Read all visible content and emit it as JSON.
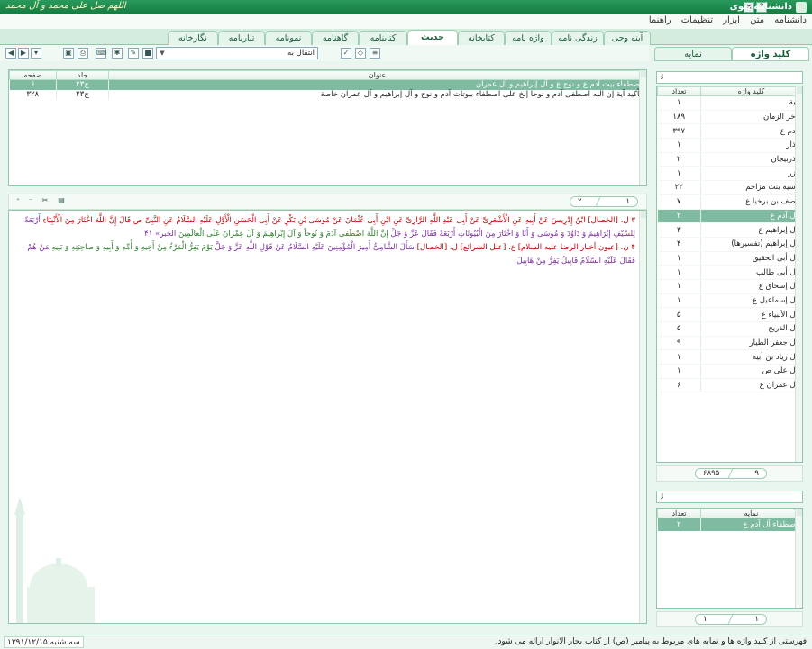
{
  "window": {
    "title": "دانشنامه نبوی",
    "calligraphy": "اللهم صل على محمد و آل محمد",
    "help_btn": "?",
    "close_btn": "×"
  },
  "menu": [
    "دانشنامه",
    "متن",
    "ابزار",
    "تنظیمات",
    "راهنما"
  ],
  "main_tabs": [
    {
      "label": "آینه وحی"
    },
    {
      "label": "زندگی نامه"
    },
    {
      "label": "واژه نامه"
    },
    {
      "label": "کتابخانه"
    },
    {
      "label": "حدیث",
      "active": true
    },
    {
      "label": "کتابنامه"
    },
    {
      "label": "گاهنامه"
    },
    {
      "label": "نمونامه"
    },
    {
      "label": "تبارنامه"
    },
    {
      "label": "نگارخانه"
    }
  ],
  "toolbar": {
    "combo_label": "انتقال به",
    "icons": [
      "back-icon",
      "forward-icon",
      "refresh-icon",
      "bookmark-icon",
      "print-icon",
      "keyboard-icon",
      "settings-icon",
      "edit-icon"
    ]
  },
  "right_tabs": [
    {
      "label": "کلید واژه",
      "active": true
    },
    {
      "label": "نمایه"
    }
  ],
  "results": {
    "headers": {
      "title": "عنوان",
      "volume": "جلد",
      "page": "صفحه"
    },
    "rows": [
      {
        "title": "اصطفاء بیت آدم ع و نوح ع و آل إبراهیم و آل عمران",
        "volume": "ج۲۳",
        "page": "۶",
        "selected": true
      },
      {
        "title": "تأکید آیة إن الله اصطفی آدم و نوحا إلخ علی اصطفاء بیوتات آدم و نوح و آل إبراهیم و آل عمران خاصة",
        "volume": "ج۲۳",
        "page": "۳۲۸"
      }
    ]
  },
  "results_pager": {
    "current": "۱",
    "total": "۲"
  },
  "text": {
    "line1_num": "۳ ل، [الخصال]",
    "line1": "ابْنُ إِدْرِیسَ عَنْ أَبِیهِ عَنِ الْأَشْعَرِیِّ عَنْ أَبِی عَبْدِ اللَّهِ الرَّازِیِّ عَنِ ابْنِ أَبِی عُثْمَانَ عَنْ مُوسَى بْنِ بَکْرٍ عَنْ أَبِی الْحَسَنِ الْأَوَّلِ عَلَیْهِ السَّلَامُ عَنِ النَّبِیِّ ص قَالَ إِنَّ اللَّهَ اخْتَارَ مِنَ الْأَنْبِیَاءِ",
    "line2": "أَرْبَعَةً لِلسَّیْفِ إِبْرَاهِیمَ وَ دَاوُدَ وَ مُوسَى وَ أَنَا وَ اخْتَارَ مِنَ الْبُیُوتَاتِ أَرْبَعَةً فَقَالَ عَزَّ وَ جَلَّ",
    "line2_quran": "إِنَّ اللَّهَ اصْطَفى‏ آدَمَ وَ نُوحاً وَ آلَ إِبْراهِیمَ وَ آلَ عِمْرانَ عَلَى الْعالَمِینَ",
    "line2_ref": "الخبر» ۴۱",
    "line3_num": "۴ ن، [عیون أخبار الرضا علیه السلام] ع، [علل الشرائع] ل، [الخصال]",
    "line3": "سَأَلَ الشَّامِیُّ أَمِیرَ الْمُؤْمِنِینَ عَلَیْهِ السَّلَامُ عَنْ قَوْلِ اللَّهِ عَزَّ وَ جَلَّ",
    "line3_quran": "یَوْمَ یَفِرُّ الْمَرْءُ مِنْ أَخِیهِ وَ أُمِّهِ وَ أَبِیهِ وَ صاحِبَتِهِ",
    "line4_quran": "وَ بَنِیهِ",
    "line4": "مَنْ هُمْ فَقَالَ عَلَیْهِ السَّلَامُ قَابِیلُ یَفِرُّ مِنْ هَابِیلَ"
  },
  "keywords": {
    "headers": {
      "term": "کلید واژه",
      "count": "تعداد"
    },
    "rows": [
      {
        "term": "آیة",
        "count": "۱"
      },
      {
        "term": "آخر الزمان",
        "count": "۱۸۹"
      },
      {
        "term": "آدم ع",
        "count": "۳۹۷"
      },
      {
        "term": "آذار",
        "count": "۱"
      },
      {
        "term": "آذربیجان",
        "count": "۲"
      },
      {
        "term": "آزر",
        "count": "۱"
      },
      {
        "term": "آسیة بنت مزاحم",
        "count": "۲۲"
      },
      {
        "term": "آصف بن برخیا ع",
        "count": "۷"
      },
      {
        "term": "آل آدم ع",
        "count": "۲",
        "selected": true
      },
      {
        "term": "آل إبراهیم ع",
        "count": "۳"
      },
      {
        "term": "آل إبراهیم (تفسیرها)",
        "count": "۴"
      },
      {
        "term": "آل أبی الحقیق",
        "count": "۱"
      },
      {
        "term": "آل أبی طالب",
        "count": "۱"
      },
      {
        "term": "آل إسحاق ع",
        "count": "۱"
      },
      {
        "term": "آل إسماعیل ع",
        "count": "۱"
      },
      {
        "term": "آل الأنبیاء ع",
        "count": "۵"
      },
      {
        "term": "آل الذریح",
        "count": "۵"
      },
      {
        "term": "آل جعفر الطیار",
        "count": "۹"
      },
      {
        "term": "آل زیاد بن أبیه",
        "count": "۱"
      },
      {
        "term": "آل علی ص",
        "count": "۱"
      },
      {
        "term": "آل عمران ع",
        "count": "۶"
      }
    ]
  },
  "keywords_pager": {
    "current": "۹",
    "total": "۶۸۹۵"
  },
  "index": {
    "headers": {
      "term": "نمایه",
      "count": "تعداد"
    },
    "rows": [
      {
        "term": "اصطفاء آل آدم ع",
        "count": "۲",
        "selected": true
      }
    ]
  },
  "index_pager": {
    "current": "۱",
    "total": "۱"
  },
  "status": {
    "message": "فهرستی از کلید واژه ها و نمایه های مربوط به پیامبر (ص) از کتاب بحار الانوار ارائه می شود.",
    "date": "سه شنبه ۱۳۹۱/۱۲/۱۵"
  }
}
